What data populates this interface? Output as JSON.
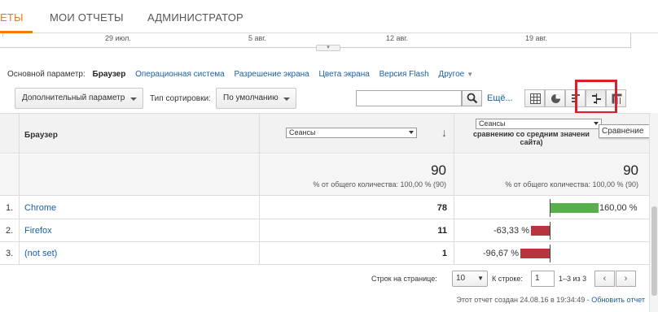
{
  "nav": {
    "tabs": [
      {
        "label": "ЕТЫ"
      },
      {
        "label": "МОИ ОТЧЕТЫ"
      },
      {
        "label": "АДМИНИСТРАТОР"
      }
    ]
  },
  "timeline": {
    "dates": [
      "29 июл.",
      "5 авг.",
      "12 авг.",
      "19 авг."
    ]
  },
  "dimensions": {
    "label": "Основной параметр:",
    "current": "Браузер",
    "links": [
      "Операционная система",
      "Разрешение экрана",
      "Цвета экрана",
      "Версия Flash"
    ],
    "more": "Другое"
  },
  "toolbar": {
    "secondary_dim": "Дополнительный параметр",
    "sort_label": "Тип сортировки:",
    "sort_value": "По умолчанию",
    "search_placeholder": "",
    "more_link": "Ещё..."
  },
  "tooltip": "Сравнение",
  "table": {
    "col_browser": "Браузер",
    "metric_select": "Сеансы",
    "compare_select": "Сеансы",
    "compare_header": "сравнению со средним значени сайта)",
    "totals": {
      "sessions": "90",
      "sessions_sub": "% от общего количества: 100,00 % (90)",
      "compare": "90",
      "compare_sub": "% от общего количества: 100,00 % (90)"
    },
    "rows": [
      {
        "idx": "1.",
        "name": "Chrome",
        "value": "78",
        "pct": "160,00 %",
        "change": 1.6,
        "color": "#57b04c"
      },
      {
        "idx": "2.",
        "name": "Firefox",
        "value": "11",
        "pct": "-63,33 %",
        "change": -0.6333,
        "color": "#b8343f"
      },
      {
        "idx": "3.",
        "name": "(not set)",
        "value": "1",
        "pct": "-96,67 %",
        "change": -0.9667,
        "color": "#b8343f"
      }
    ]
  },
  "pager": {
    "rows_label": "Строк на странице:",
    "rows_value": "10",
    "goto_label": "К строке:",
    "goto_value": "1",
    "range": "1–3 из 3"
  },
  "footer": {
    "text": "Этот отчет создан 24.08.16 в 19:34:49 -",
    "link": "Обновить отчет"
  },
  "colors": {
    "accent": "#f57c00",
    "positive": "#57b04c",
    "negative": "#b8343f",
    "link": "#1a5fa8",
    "highlight": "#d9202a"
  }
}
